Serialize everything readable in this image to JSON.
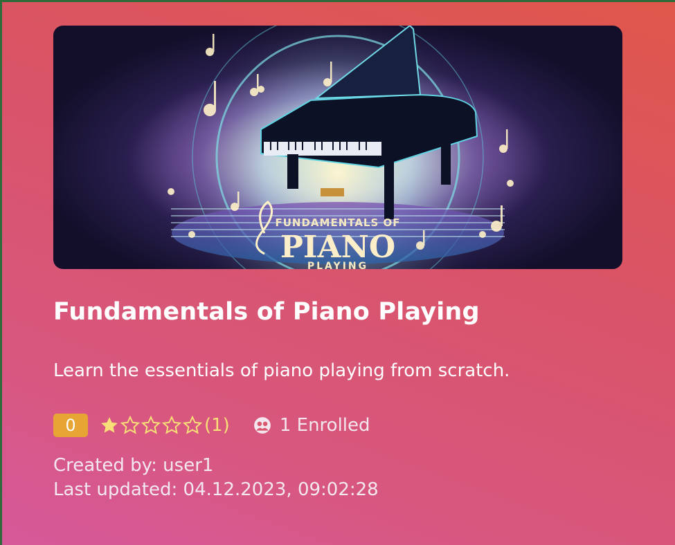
{
  "course": {
    "image_alt": "Fundamentals of Piano Playing",
    "image_text_line1": "FUNDAMENTALS OF",
    "image_text_line2": "PIANO",
    "image_text_line3": "PLAYING",
    "title": "Fundamentals of Piano Playing",
    "description": "Learn the essentials of piano playing from scratch.",
    "price_badge": "0",
    "rating_value": 1,
    "rating_max": 5,
    "rating_count": "(1)",
    "enrolled_text": "1 Enrolled",
    "created_by": "Created by: user1",
    "last_updated": "Last updated: 04.12.2023, 09:02:28"
  },
  "icons": {
    "star_filled": "star-filled-icon",
    "star_empty": "star-outline-icon",
    "enrolled": "users-icon"
  },
  "colors": {
    "badge": "#e7a534",
    "star": "#f9df78",
    "card_gradient_top": "#e0574b",
    "card_gradient_bottom": "#d6599a"
  }
}
